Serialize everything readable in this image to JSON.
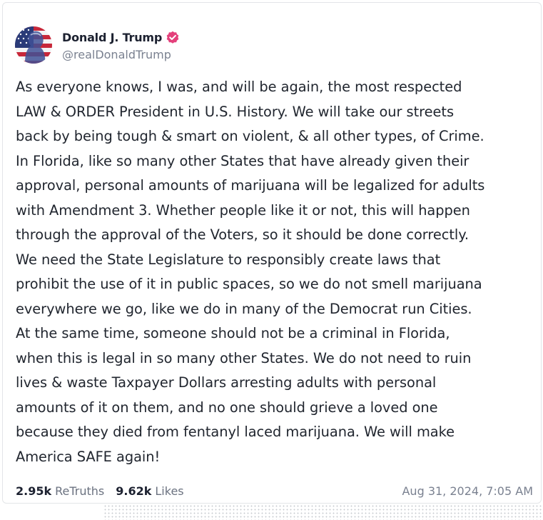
{
  "author": {
    "display_name": "Donald J. Trump",
    "handle": "@realDonaldTrump",
    "avatar_icon": "avatar-flag-portrait",
    "verified_icon": "verified-badge-icon",
    "verified_color": "#e4407b"
  },
  "post": {
    "lines": [
      "As everyone knows, I was, and will be again, the most respected",
      "LAW & ORDER President in U.S. History. We will take our streets",
      "back by being tough & smart on violent, & all other types, of Crime.",
      "In Florida, like so many other States that have already given their",
      "approval, personal amounts of marijuana will be legalized for adults",
      "with Amendment 3. Whether people like it or not, this will happen",
      "through the approval of the Voters, so it should be done correctly.",
      "We need the State Legislature to responsibly create laws that",
      "prohibit the use of it in public spaces, so we do not smell marijuana",
      "everywhere we go, like we do in many of the Democrat run Cities.",
      "At the same time, someone should not be a criminal in Florida,",
      "when this is legal in so many other States. We do not need to ruin",
      "lives & waste Taxpayer Dollars arresting adults with personal",
      "amounts of it on them, and no one should grieve a loved one",
      "because they died from fentanyl laced marijuana. We will make",
      "America SAFE again!"
    ]
  },
  "stats": {
    "retruths_count": "2.95k",
    "retruths_label": "ReTruths",
    "likes_count": "9.62k",
    "likes_label": "Likes"
  },
  "timestamp": "Aug 31, 2024, 7:05 AM"
}
